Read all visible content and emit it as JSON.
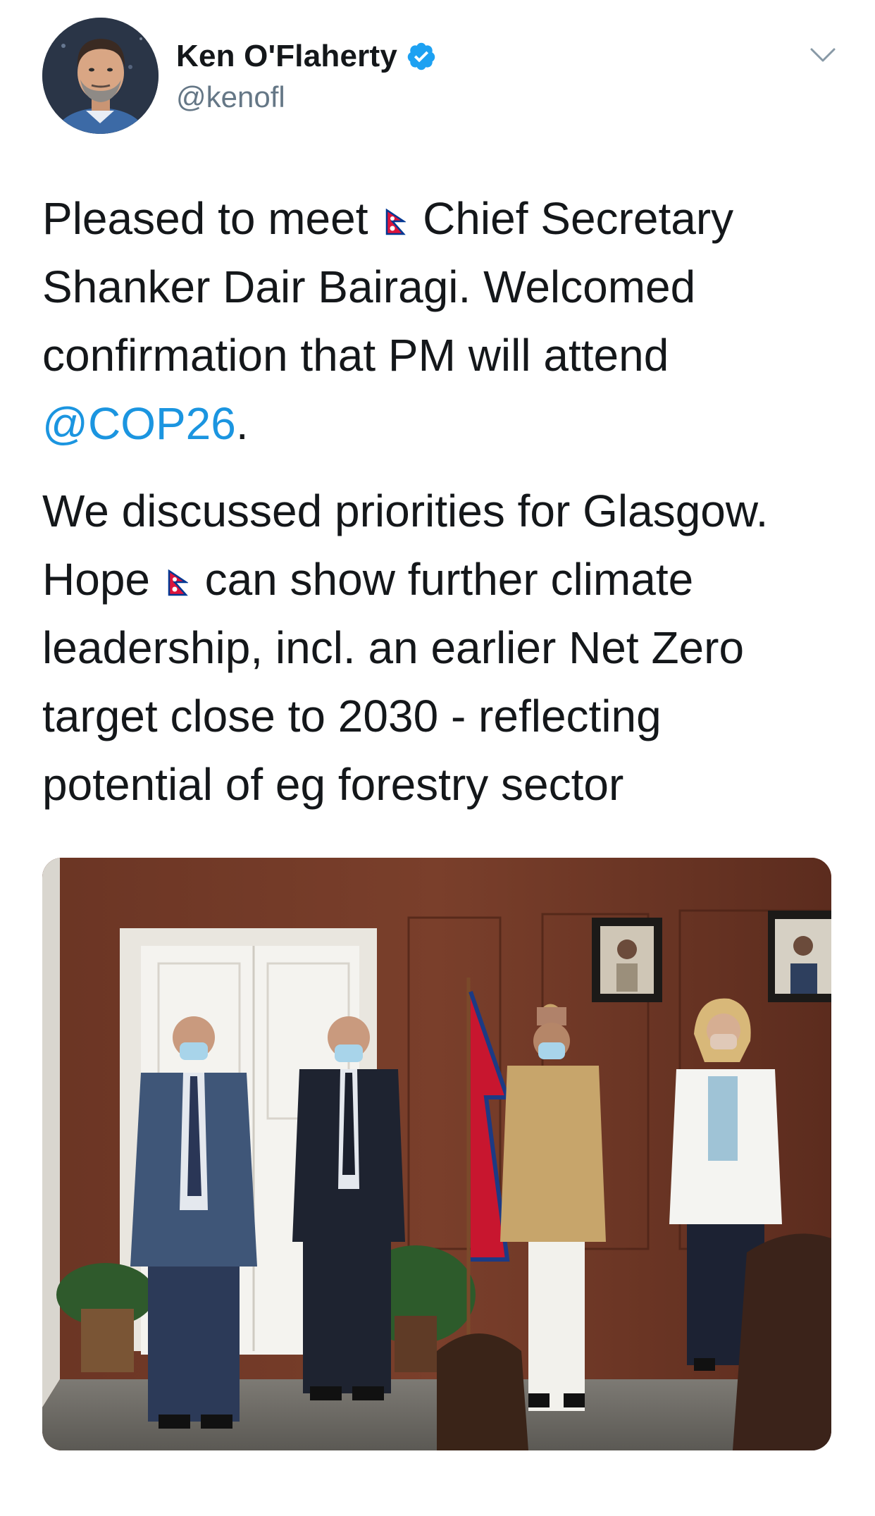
{
  "tweet": {
    "author": {
      "name": "Ken O'Flaherty",
      "handle": "@kenofl",
      "verified": true
    },
    "text": {
      "line1_a": "Pleased to meet ",
      "line1_b": " Chief Secretary",
      "line2": "Shanker Dair Bairagi. Welcomed",
      "line3": "confirmation that PM will attend",
      "mention": "@COP26",
      "mention_suffix": ".",
      "p2_line1": "We discussed priorities for Glasgow.",
      "p2_line2_a": "Hope ",
      "p2_line2_b": "  can show further climate",
      "p2_line3": "leadership, incl. an earlier Net Zero",
      "p2_line4": "target close to 2030 - reflecting",
      "p2_line5": "potential of eg forestry sector"
    },
    "icons": {
      "verified": "verified-badge-icon",
      "menu": "chevron-down-icon",
      "flag": "nepal-flag-emoji"
    },
    "colors": {
      "link": "#1b95e0",
      "verified": "#1da1f2",
      "secondary_text": "#657786",
      "flag_red": "#dc143c",
      "flag_blue": "#003893"
    }
  }
}
